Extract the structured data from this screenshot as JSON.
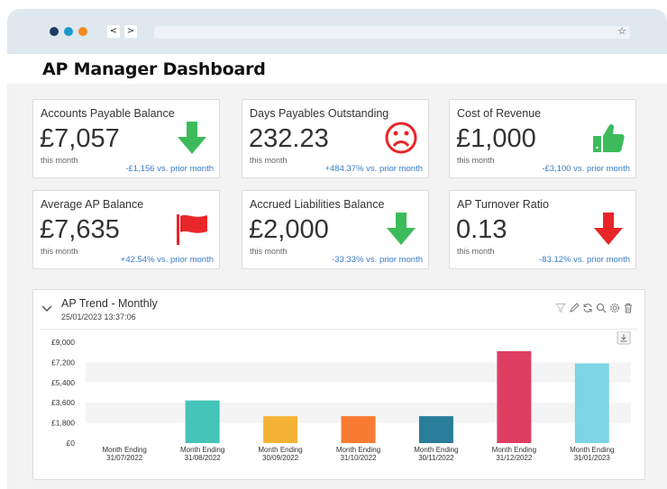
{
  "browser": {
    "back_label": "<",
    "forward_label": ">",
    "star_icon": "star-icon"
  },
  "app": {
    "title": "AP Manager Dashboard"
  },
  "kpis": [
    {
      "title": "Accounts Payable Balance",
      "value": "£7,057",
      "sub": "this month",
      "change": "-£1,156 vs. prior month",
      "icon": "arrow-down-icon",
      "icon_color": "#3dbb5a"
    },
    {
      "title": "Days Payables Outstanding",
      "value": "232.23",
      "sub": "this month",
      "change": "+484.37% vs. prior month",
      "icon": "sad-face-icon",
      "icon_color": "#e8262a"
    },
    {
      "title": "Cost of Revenue",
      "value": "£1,000",
      "sub": "this month",
      "change": "-£3,100 vs. prior month",
      "icon": "thumbs-up-icon",
      "icon_color": "#3dbb5a"
    },
    {
      "title": "Average AP Balance",
      "value": "£7,635",
      "sub": "this month",
      "change": "+42.54% vs. prior month",
      "icon": "flag-icon",
      "icon_color": "#e8262a"
    },
    {
      "title": "Accrued Liabilities Balance",
      "value": "£2,000",
      "sub": "this month",
      "change": "-33.33% vs. prior month",
      "icon": "arrow-down-icon",
      "icon_color": "#3dbb5a"
    },
    {
      "title": "AP Turnover Ratio",
      "value": "0.13",
      "sub": "this month",
      "change": "-83.12% vs. prior month",
      "icon": "arrow-down-icon",
      "icon_color": "#e8262a"
    }
  ],
  "panel": {
    "title": "AP Trend - Monthly",
    "timestamp": "25/01/2023 13:37:06",
    "tools": [
      "filter-icon",
      "edit-icon",
      "refresh-icon",
      "search-icon",
      "settings-icon",
      "delete-icon"
    ],
    "download_icon": "download-icon"
  },
  "chart_data": {
    "type": "bar",
    "categories": [
      [
        "Month Ending",
        "31/07/2022"
      ],
      [
        "Month Ending",
        "31/08/2022"
      ],
      [
        "Month Ending",
        "30/09/2022"
      ],
      [
        "Month Ending",
        "31/10/2022"
      ],
      [
        "Month Ending",
        "30/11/2022"
      ],
      [
        "Month Ending",
        "31/12/2022"
      ],
      [
        "Month Ending",
        "31/01/2023"
      ]
    ],
    "values": [
      0,
      3800,
      2400,
      2400,
      2400,
      8200,
      7100
    ],
    "colors": [
      "#cccccc",
      "#45c4b8",
      "#f5b335",
      "#f97a33",
      "#2a7e9a",
      "#de3e62",
      "#7cd4e4"
    ],
    "yticks": [
      "£9,000",
      "£7,200",
      "£5,400",
      "£3,600",
      "£1,800",
      "£0"
    ],
    "ytick_values": [
      9000,
      7200,
      5400,
      3600,
      1800,
      0
    ],
    "ylim": [
      0,
      9000
    ],
    "grid": "banded",
    "title": "",
    "xlabel": "",
    "ylabel": ""
  }
}
